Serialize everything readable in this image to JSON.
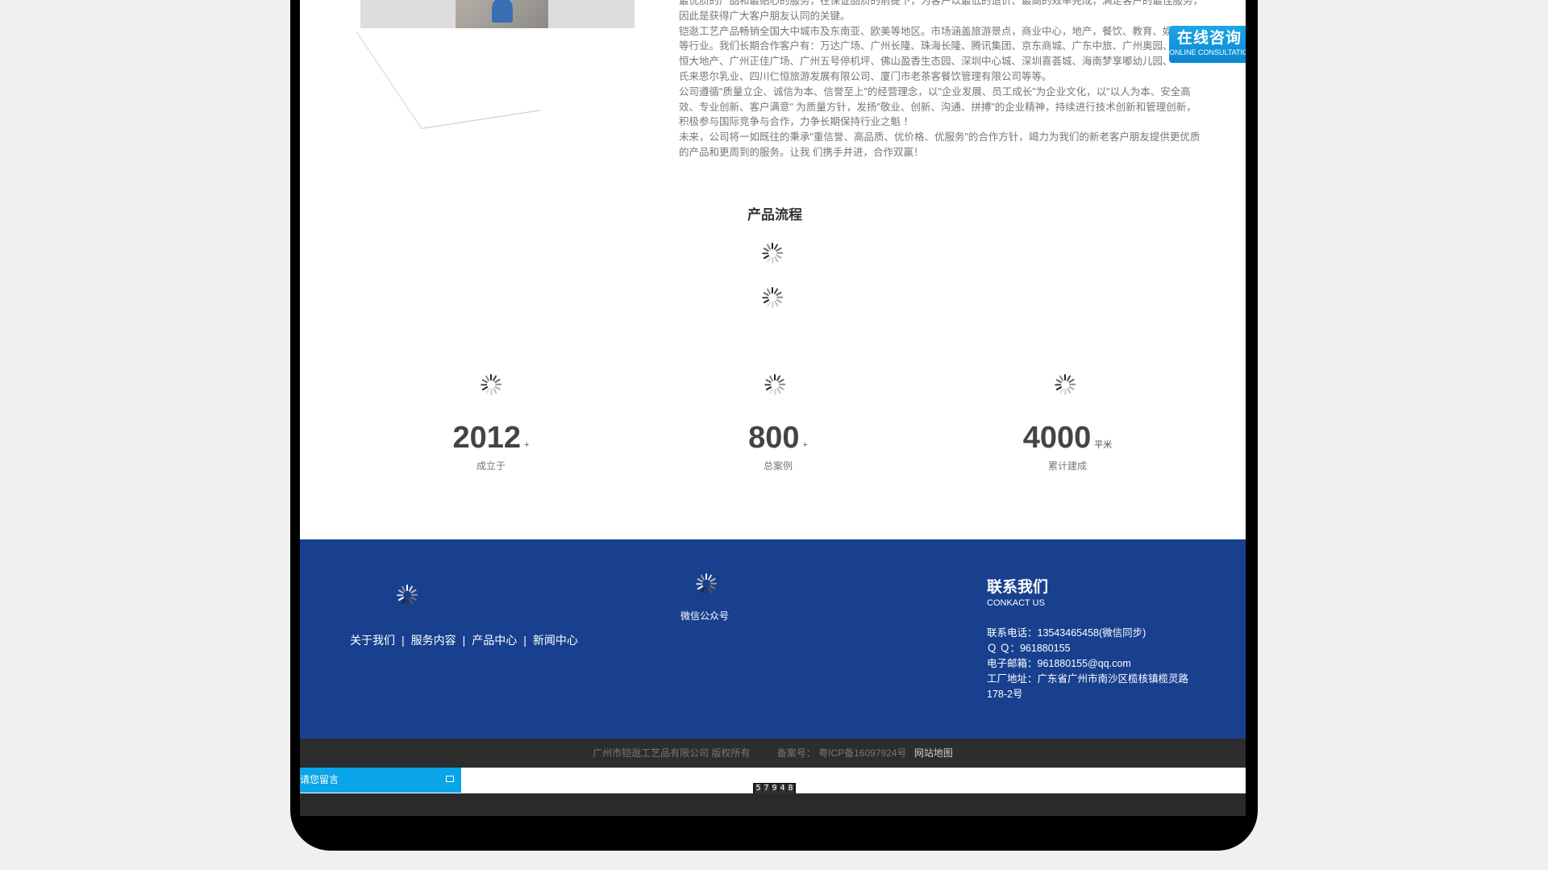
{
  "about": {
    "paragraphs": [
      "最优质的产品和最贴心的服务，在保证品质的前提下，为客户以最低的造价、最高的效率完成，满足客户的最佳服务，",
      "因此是获得广大客户朋友认同的关键。",
      "铠逖工艺产品畅销全国大中城市及东南亚、欧美等地区。市场涵盖旅游景点，商业中心，地产，餐饮、教育、娱乐场所",
      "等行业。我们长期合作客户有：万达广场、广州长隆、珠海长隆、腾讯集团、京东商城、广东中旅、广州奥园、",
      "恒大地产、广州正佳广场、广州五号停机坪、佛山盈香生态园、深圳中心城、深圳喜荟城、海南梦享嘟幼儿园、",
      "氏来思尔乳业、四川仁恒旅游发展有限公司、厦门市老茶客餐饮管理有限公司等等。",
      "公司遵循\"质量立企、诚信为本、信誉至上\"的经营理念，以\"企业发展、员工成长\"为企业文化，以\"以人为本、安全高",
      "效、专业创新、客户满意\" 为质量方针，发扬\"敬业、创新、沟通、拼搏\"的企业精神，持续进行技术创新和管理创新，",
      "积极参与国际竞争与合作，力争长期保持行业之魁 ！",
      " 未来，公司将一如既往的秉承\"重信誉、高品质、优价格、优服务\"的合作方针，竭力为我们的新老客户朋友提供更优质",
      "的产品和更周到的服务。让我 们携手并进，合作双赢！"
    ]
  },
  "consult": {
    "cn": "在线咨询",
    "en": "ONLINE CONSULTATION"
  },
  "process": {
    "title": "产品流程"
  },
  "stats": [
    {
      "num": "2012",
      "unit": "+",
      "label": "成立于"
    },
    {
      "num": "800",
      "unit": "+",
      "label": "总案例"
    },
    {
      "num": "4000",
      "unit": "平米",
      "label": "累计建成"
    }
  ],
  "footer": {
    "links": [
      "关于我们",
      "服务内容",
      "产品中心",
      "新闻中心"
    ],
    "separator": "|",
    "wechat_label": "微信公众号",
    "contact_title": "联系我们",
    "contact_sub": "CONKACT US",
    "phone": "联系电话：13543465458(微信同步)",
    "qq": "Ｑ Ｑ：961880155",
    "email": "电子邮箱：961880155@qq.com",
    "address": "工厂地址：广东省广州市南沙区榄核镇榄灵路178-2号"
  },
  "copyright": {
    "company": "广州市铠逖工艺品有限公司  版权所有",
    "icp": "备案号：  粤ICP备16097924号",
    "sitemap": "网站地图"
  },
  "counter": [
    "5",
    "7",
    "9",
    "4",
    "8"
  ],
  "message_bar": {
    "label": "请您留言"
  }
}
